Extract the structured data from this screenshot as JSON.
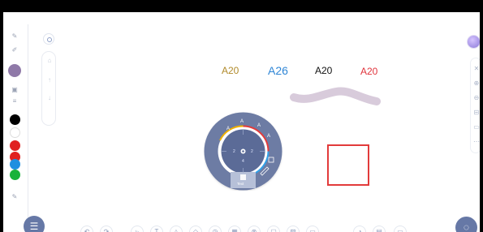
{
  "canvas": {
    "text_samples": [
      {
        "text": "A20",
        "color": "#b08a2a"
      },
      {
        "text": "A26",
        "color": "#2f86d6"
      },
      {
        "text": "A20",
        "color": "#111111"
      },
      {
        "text": "A20",
        "color": "#e0343c"
      }
    ],
    "stroke_color": "#d8cbdb",
    "rect_color": "#e23b3b"
  },
  "left_palette": {
    "tools": [
      "eraser-pen-icon",
      "text-pen-icon"
    ],
    "pen_color": "#8f79a8",
    "colors": [
      "#000000",
      "#ffffff",
      "#e02020",
      "#e02020",
      "#1f8fe0",
      "#19b23a"
    ]
  },
  "mini_toolbar": {
    "icons": [
      "target-icon",
      "bucket-icon",
      "arrow-up-icon",
      "arrow-down-icon"
    ]
  },
  "wheel": {
    "labels": [
      "A",
      "A",
      "A",
      "A",
      "2",
      "2",
      "4"
    ],
    "footer_label": "Text"
  },
  "right_toolbar": {
    "icons": [
      "close-icon",
      "zoom-in-icon",
      "zoom-out-icon",
      "fit-icon",
      "screen-icon",
      "more-icon"
    ]
  },
  "bottom_toolbar": {
    "icons": [
      "undo-icon",
      "redo-icon",
      "select-icon",
      "text-tool-icon",
      "shape-tool-icon",
      "eraser-icon",
      "clock-icon",
      "table-icon",
      "globe-icon",
      "frame-icon",
      "image-icon",
      "note-icon",
      "user-icon",
      "template-icon",
      "export-icon"
    ]
  }
}
